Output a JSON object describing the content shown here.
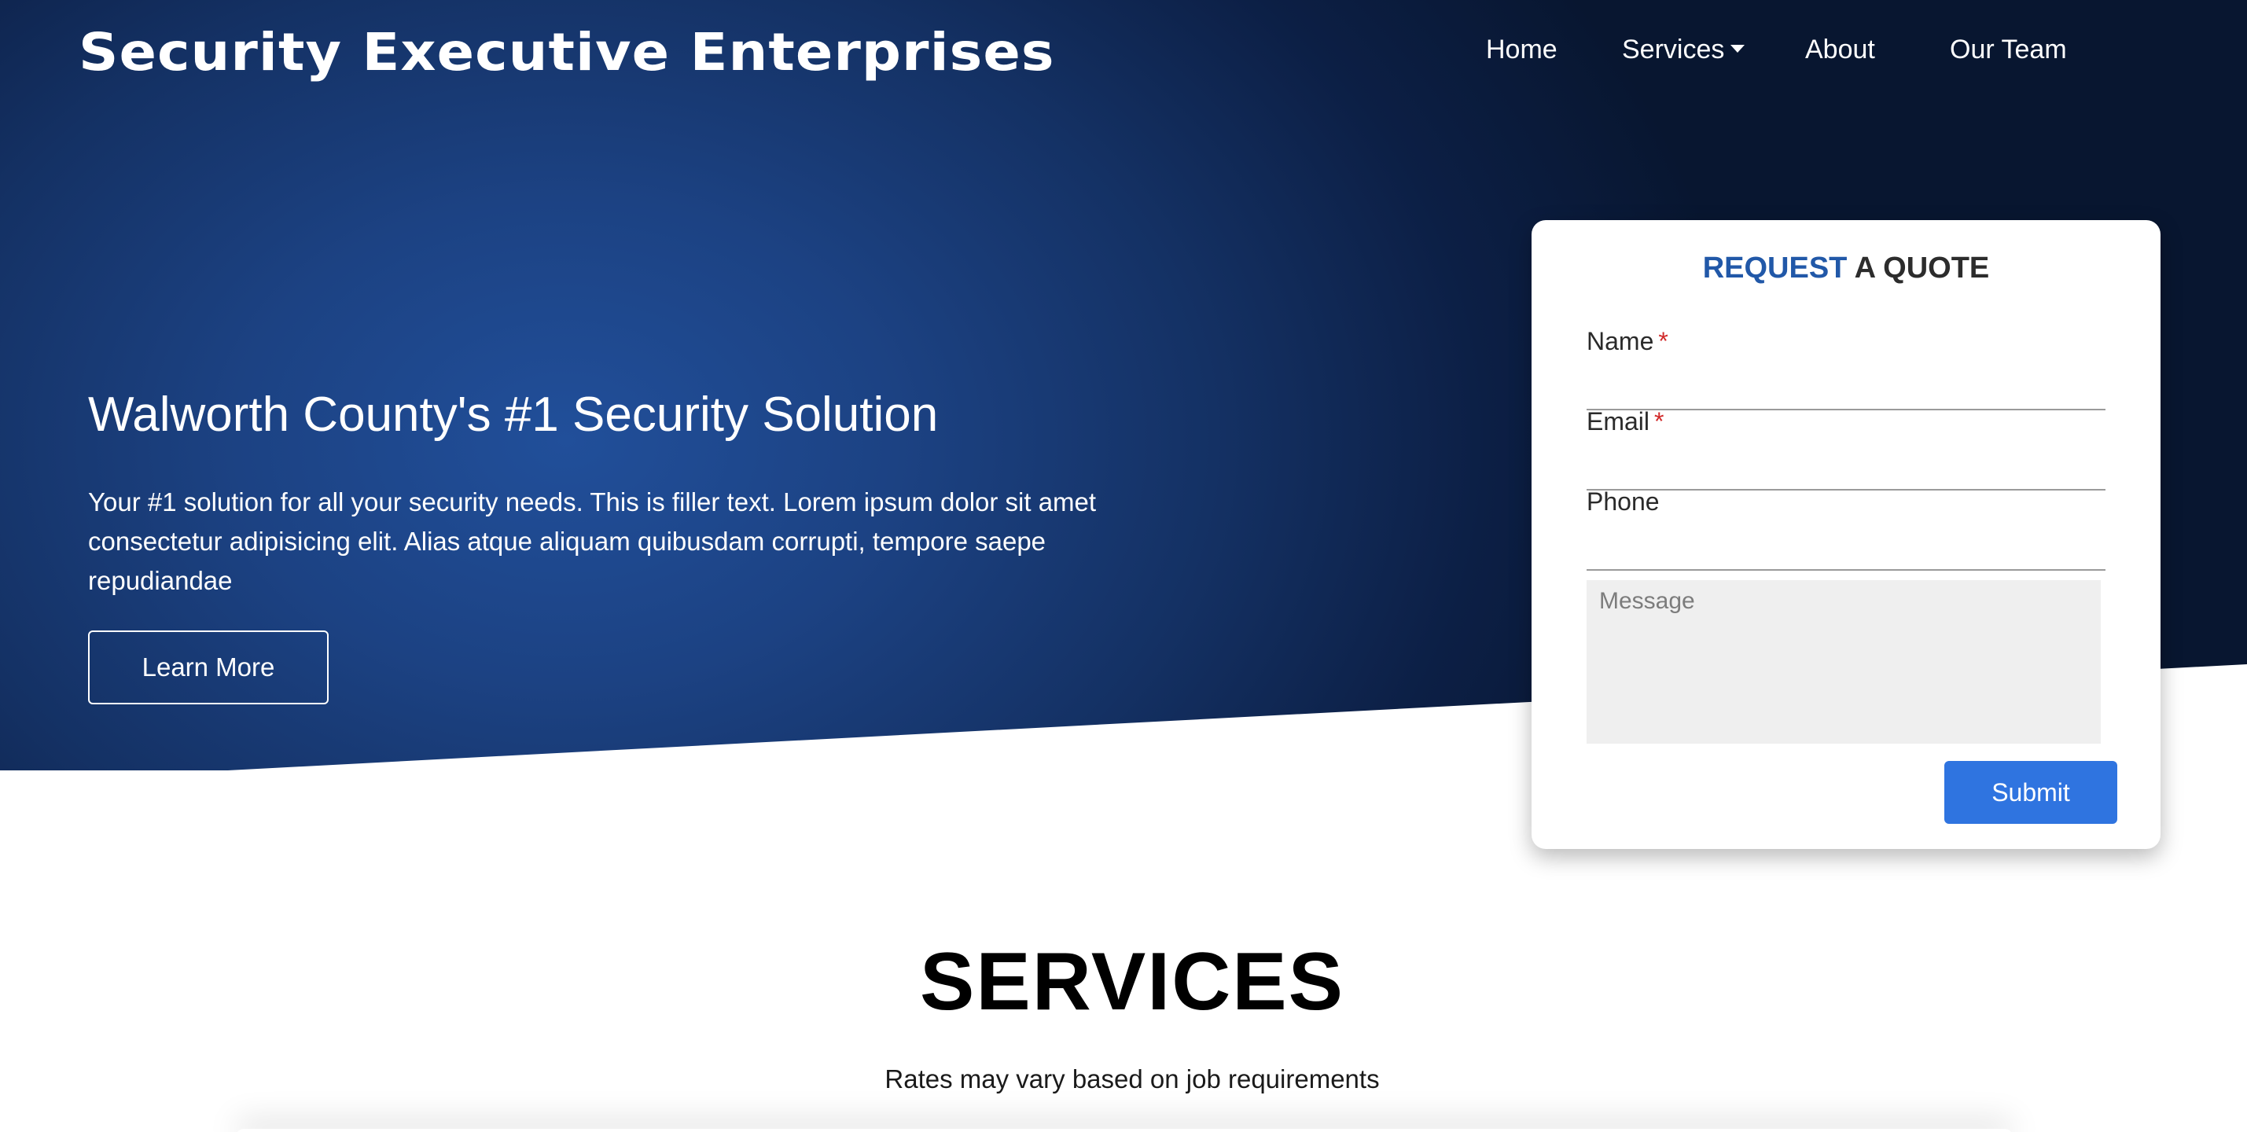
{
  "header": {
    "brand": "Security Executive Enterprises",
    "nav": {
      "home": "Home",
      "services": "Services",
      "about": "About",
      "team": "Our Team"
    }
  },
  "hero": {
    "title": "Walworth County's #1 Security Solution",
    "description": "Your #1 solution for all your security needs. This is filler text. Lorem ipsum dolor sit amet consectetur adipisicing elit. Alias atque aliquam quibusdam corrupti, tempore saepe repudiandae",
    "cta_label": "Learn More"
  },
  "quote_form": {
    "title_accent": "REQUEST",
    "title_rest": "A QUOTE",
    "fields": {
      "name": {
        "label": "Name",
        "required_mark": "*"
      },
      "email": {
        "label": "Email",
        "required_mark": "*"
      },
      "phone": {
        "label": "Phone"
      }
    },
    "message_placeholder": "Message",
    "submit_label": "Submit"
  },
  "services": {
    "heading": "SERVICES",
    "subheading": "Rates may vary based on job requirements"
  },
  "colors": {
    "hero_blue": "#1c4283",
    "hero_dark": "#081630",
    "accent": "#2158a8",
    "submit_button": "#2f74e0",
    "required": "#d12a2a"
  },
  "icons": {
    "services_dropdown": "caret-down-icon"
  }
}
